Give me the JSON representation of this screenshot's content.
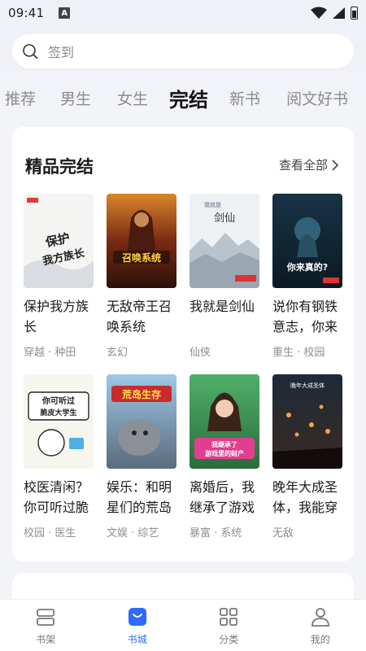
{
  "status_bar": {
    "time": "09:41",
    "notif_letter": "A"
  },
  "search": {
    "placeholder": "签到"
  },
  "tabs": [
    {
      "label": "推荐",
      "active": false
    },
    {
      "label": "男生",
      "active": false
    },
    {
      "label": "女生",
      "active": false
    },
    {
      "label": "完结",
      "active": true
    },
    {
      "label": "新书",
      "active": false
    },
    {
      "label": "阅文好书",
      "active": false
    }
  ],
  "section": {
    "title": "精品完结",
    "more": "查看全部"
  },
  "books": [
    {
      "title": "保护我方族长",
      "tags": "穿越 · 种田",
      "cover_text": "保护我方族长"
    },
    {
      "title": "无敌帝王召唤系统",
      "tags": "玄幻",
      "cover_text": "召唤系统"
    },
    {
      "title": "我就是剑仙",
      "tags": "仙侠",
      "cover_text": "我就是剑仙"
    },
    {
      "title": "说你有钢铁意志，你来",
      "tags": "重生 · 校园",
      "cover_text": "你来真的?"
    },
    {
      "title": "校医清闲？你可听过脆",
      "tags": "校园 · 医生",
      "cover_text": "你可听过脆皮大学生"
    },
    {
      "title": "娱乐：和明星们的荒岛",
      "tags": "文娱 · 综艺",
      "cover_text": "荒岛生存"
    },
    {
      "title": "离婚后，我继承了游戏",
      "tags": "暴富 · 系统",
      "cover_text": "我继承了游戏里的财产"
    },
    {
      "title": "晚年大成圣体，我能穿",
      "tags": "无敌",
      "cover_text": "晚年大成圣体"
    }
  ],
  "bottom_nav": [
    {
      "label": "书架",
      "icon": "bookshelf-icon",
      "active": false
    },
    {
      "label": "书城",
      "icon": "bookstore-icon",
      "active": true
    },
    {
      "label": "分类",
      "icon": "category-icon",
      "active": false
    },
    {
      "label": "我的",
      "icon": "profile-icon",
      "active": false
    }
  ],
  "colors": {
    "accent": "#2e6bff",
    "text": "#1a1a1a",
    "muted": "#8f8f8f"
  }
}
